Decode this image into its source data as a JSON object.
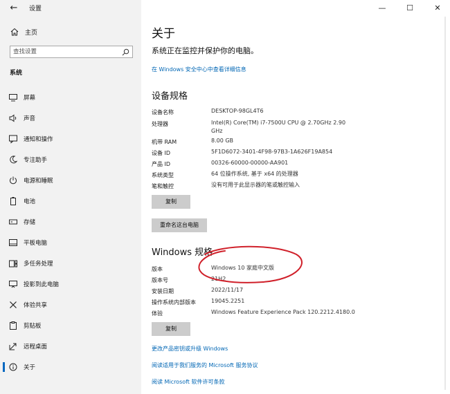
{
  "titlebar": {
    "app_title": "设置",
    "back_glyph": "←",
    "minimize_glyph": "—",
    "maximize_glyph": "☐",
    "close_glyph": "✕"
  },
  "sidebar": {
    "home_label": "主页",
    "search_placeholder": "查找设置",
    "section_title": "系统",
    "items": [
      {
        "label": "屏幕",
        "icon": "monitor-icon"
      },
      {
        "label": "声音",
        "icon": "speaker-icon"
      },
      {
        "label": "通知和操作",
        "icon": "notification-icon"
      },
      {
        "label": "专注助手",
        "icon": "moon-icon"
      },
      {
        "label": "电源和睡眠",
        "icon": "power-icon"
      },
      {
        "label": "电池",
        "icon": "battery-icon"
      },
      {
        "label": "存储",
        "icon": "storage-icon"
      },
      {
        "label": "平板电脑",
        "icon": "tablet-icon"
      },
      {
        "label": "多任务处理",
        "icon": "multitask-icon"
      },
      {
        "label": "投影到此电脑",
        "icon": "project-icon"
      },
      {
        "label": "体验共享",
        "icon": "share-icon"
      },
      {
        "label": "剪贴板",
        "icon": "clipboard-icon"
      },
      {
        "label": "远程桌面",
        "icon": "remote-icon"
      },
      {
        "label": "关于",
        "icon": "info-icon"
      }
    ],
    "active_index": 13,
    "accent_color": "#0067c0"
  },
  "main": {
    "title": "关于",
    "protect_text": "系统正在监控并保护你的电脑。",
    "security_link": "在 Windows 安全中心中查看详细信息",
    "device_specs": {
      "heading": "设备规格",
      "rows": [
        {
          "label": "设备名称",
          "value": "DESKTOP-98GL4T6"
        },
        {
          "label": "处理器",
          "value": "Intel(R) Core(TM) i7-7500U CPU @ 2.70GHz   2.90 GHz"
        },
        {
          "label": "机带 RAM",
          "value": "8.00 GB"
        },
        {
          "label": "设备 ID",
          "value": "5F1D6072-3401-4F98-97B3-1A626F19A854"
        },
        {
          "label": "产品 ID",
          "value": "00326-60000-00000-AA901"
        },
        {
          "label": "系统类型",
          "value": "64 位操作系统, 基于 x64 的处理器"
        },
        {
          "label": "笔和触控",
          "value": "没有可用于此显示器的笔或触控输入"
        }
      ],
      "copy_button": "复制",
      "rename_button": "重命名这台电脑"
    },
    "windows_specs": {
      "heading": "Windows 规格",
      "rows": [
        {
          "label": "版本",
          "value": "Windows 10 家庭中文版"
        },
        {
          "label": "版本号",
          "value": "21H2"
        },
        {
          "label": "安装日期",
          "value": "2022/11/17"
        },
        {
          "label": "操作系统内部版本",
          "value": "19045.2251"
        },
        {
          "label": "体验",
          "value": "Windows Feature Experience Pack 120.2212.4180.0"
        }
      ],
      "copy_button": "复制"
    },
    "links": [
      "更改产品密钥或升级 Windows",
      "阅读适用于我们服务的 Microsoft 服务协议",
      "阅读 Microsoft 软件许可条款"
    ],
    "link_color": "#0066b4",
    "annotation_color": "#d0202a"
  }
}
